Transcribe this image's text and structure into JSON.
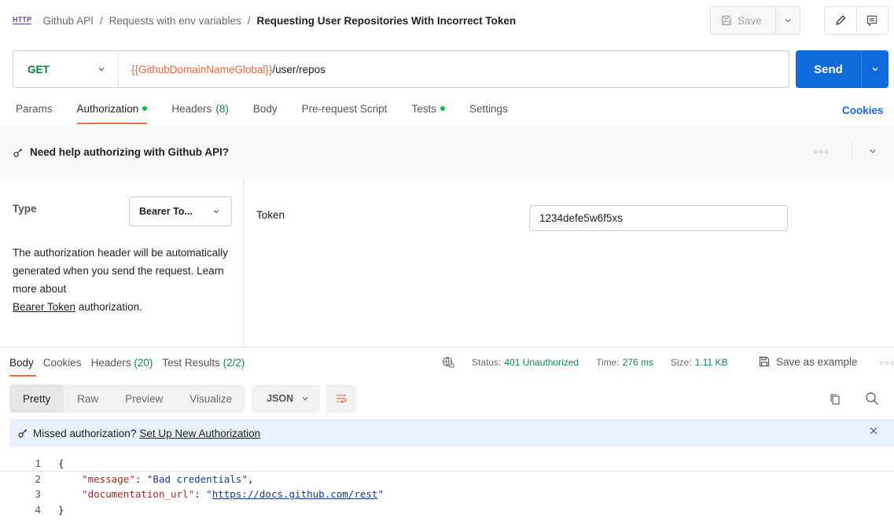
{
  "breadcrumb": {
    "icon_label": "HTTP",
    "collection": "Github API",
    "folder": "Requests with env variables",
    "request": "Requesting User Repositories With Incorrect Token",
    "separator": "/"
  },
  "toolbar": {
    "save_label": "Save"
  },
  "request": {
    "method": "GET",
    "url_variable": "{{GithubDomainNameGlobal}}",
    "url_path": "/user/repos",
    "send_label": "Send"
  },
  "request_tabs": [
    {
      "label": "Params"
    },
    {
      "label": "Authorization",
      "dot": true,
      "active": true
    },
    {
      "label": "Headers",
      "count": "(8)"
    },
    {
      "label": "Body"
    },
    {
      "label": "Pre-request Script"
    },
    {
      "label": "Tests",
      "dot": true
    },
    {
      "label": "Settings"
    }
  ],
  "cookies_link": "Cookies",
  "help_banner": {
    "text": "Need help authorizing with Github API?"
  },
  "auth": {
    "type_label": "Type",
    "type_value": "Bearer To...",
    "desc_1": "The authorization header will be automatically generated when you send the request. Learn more about",
    "desc_link": "Bearer Token",
    "desc_2": "authorization.",
    "token_label": "Token",
    "token_value": "1234defe5w6f5xs"
  },
  "response_tabs": [
    {
      "label": "Body",
      "active": true
    },
    {
      "label": "Cookies"
    },
    {
      "label": "Headers",
      "count": "(20)"
    },
    {
      "label": "Test Results",
      "count": "(2/2)"
    }
  ],
  "status": {
    "status_label": "Status:",
    "status_value": "401 Unauthorized",
    "time_label": "Time:",
    "time_value": "276 ms",
    "size_label": "Size:",
    "size_value": "1.11 KB"
  },
  "save_example_label": "Save as example",
  "view_modes": [
    "Pretty",
    "Raw",
    "Preview",
    "Visualize"
  ],
  "format": "JSON",
  "missed_auth": {
    "text": "Missed authorization?",
    "link": "Set Up New Authorization"
  },
  "code": {
    "line_numbers": [
      "1",
      "2",
      "3",
      "4"
    ],
    "open": "{",
    "key1": "\"message\"",
    "val1": "\"Bad credentials\"",
    "key2": "\"documentation_url\"",
    "val2_url": "https://docs.github.com/rest",
    "close": "}"
  },
  "colors": {
    "accent_orange": "#f26b3a",
    "send_blue": "#0f6bdc",
    "method_green": "#0a7d3f",
    "status_green": "#0a8a4f",
    "variable_orange": "#e8673c"
  }
}
